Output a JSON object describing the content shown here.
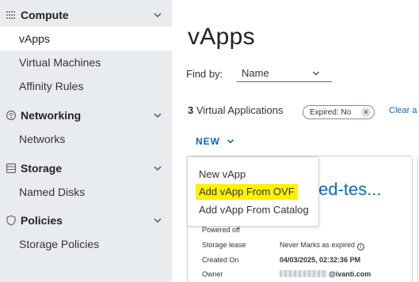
{
  "sidebar": {
    "groups": [
      {
        "title": "Compute",
        "icon": "grid-icon",
        "items": [
          "vApps",
          "Virtual Machines",
          "Affinity Rules"
        ]
      },
      {
        "title": "Networking",
        "icon": "network-icon",
        "items": [
          "Networks"
        ]
      },
      {
        "title": "Storage",
        "icon": "storage-icon",
        "items": [
          "Named Disks"
        ]
      },
      {
        "title": "Policies",
        "icon": "shield-icon",
        "items": [
          "Storage Policies"
        ]
      }
    ],
    "active_item": "vApps"
  },
  "main": {
    "title": "vApps",
    "find_by": {
      "label": "Find by:",
      "value": "Name"
    },
    "count": {
      "number": "3",
      "label": "Virtual Applications"
    },
    "filter_chip": {
      "label": "Expired:",
      "value": "No"
    },
    "clear_link": "Clear a",
    "new_button": "NEW",
    "menu": {
      "items": [
        "New vApp",
        "Add vApp From OVF",
        "Add vApp From Catalog"
      ],
      "highlighted_item": "Add vApp From OVF",
      "highlight_color": "#fff200"
    },
    "card": {
      "title_fragment": "bled-tes...",
      "status": "Powered off",
      "properties": [
        {
          "label": "Storage lease",
          "value": "Never Marks as expired"
        },
        {
          "label": "Created On",
          "value": "04/03/2025, 02:32:36 PM"
        },
        {
          "label": "Owner",
          "value": "@ivanti.com"
        }
      ]
    }
  },
  "colors": {
    "accent": "#0a6ab0",
    "sidebar_bg": "#e9ecef",
    "highlight": "#fff200"
  }
}
